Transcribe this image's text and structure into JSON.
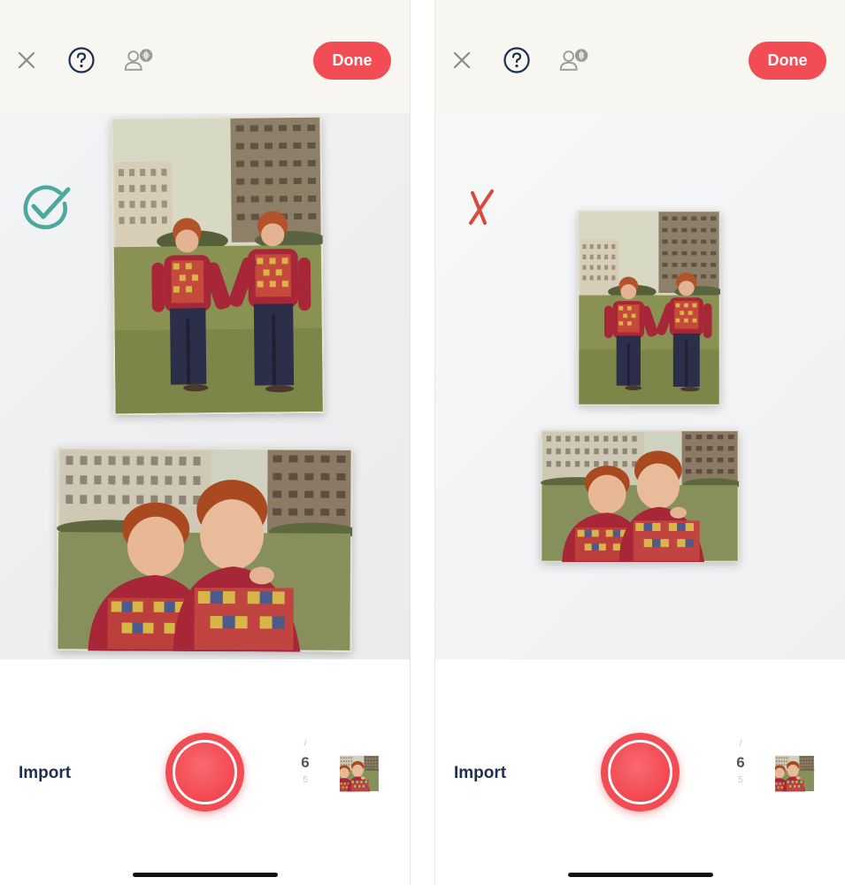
{
  "colors": {
    "accent": "#f24d55",
    "topbar_bg": "#f8f6f0",
    "import_text": "#1d2f52",
    "check_mark": "#4aa89c",
    "cross_mark": "#d84a3c"
  },
  "screens": [
    {
      "id": "correct",
      "header": {
        "close_icon": "close-icon",
        "help_icon": "help-circle-icon",
        "voice_icon": "voice-assistant-icon",
        "done_label": "Done"
      },
      "status_mark_icon": "checkmark-circle-icon",
      "bottom": {
        "import_label": "Import",
        "counter": {
          "prev": "/",
          "current": "6",
          "next": "5"
        }
      }
    },
    {
      "id": "incorrect",
      "header": {
        "close_icon": "close-icon",
        "help_icon": "help-circle-icon",
        "voice_icon": "voice-assistant-icon",
        "done_label": "Done"
      },
      "status_mark_icon": "cross-mark-icon",
      "bottom": {
        "import_label": "Import",
        "counter": {
          "prev": "/",
          "current": "6",
          "next": "5"
        }
      }
    }
  ]
}
